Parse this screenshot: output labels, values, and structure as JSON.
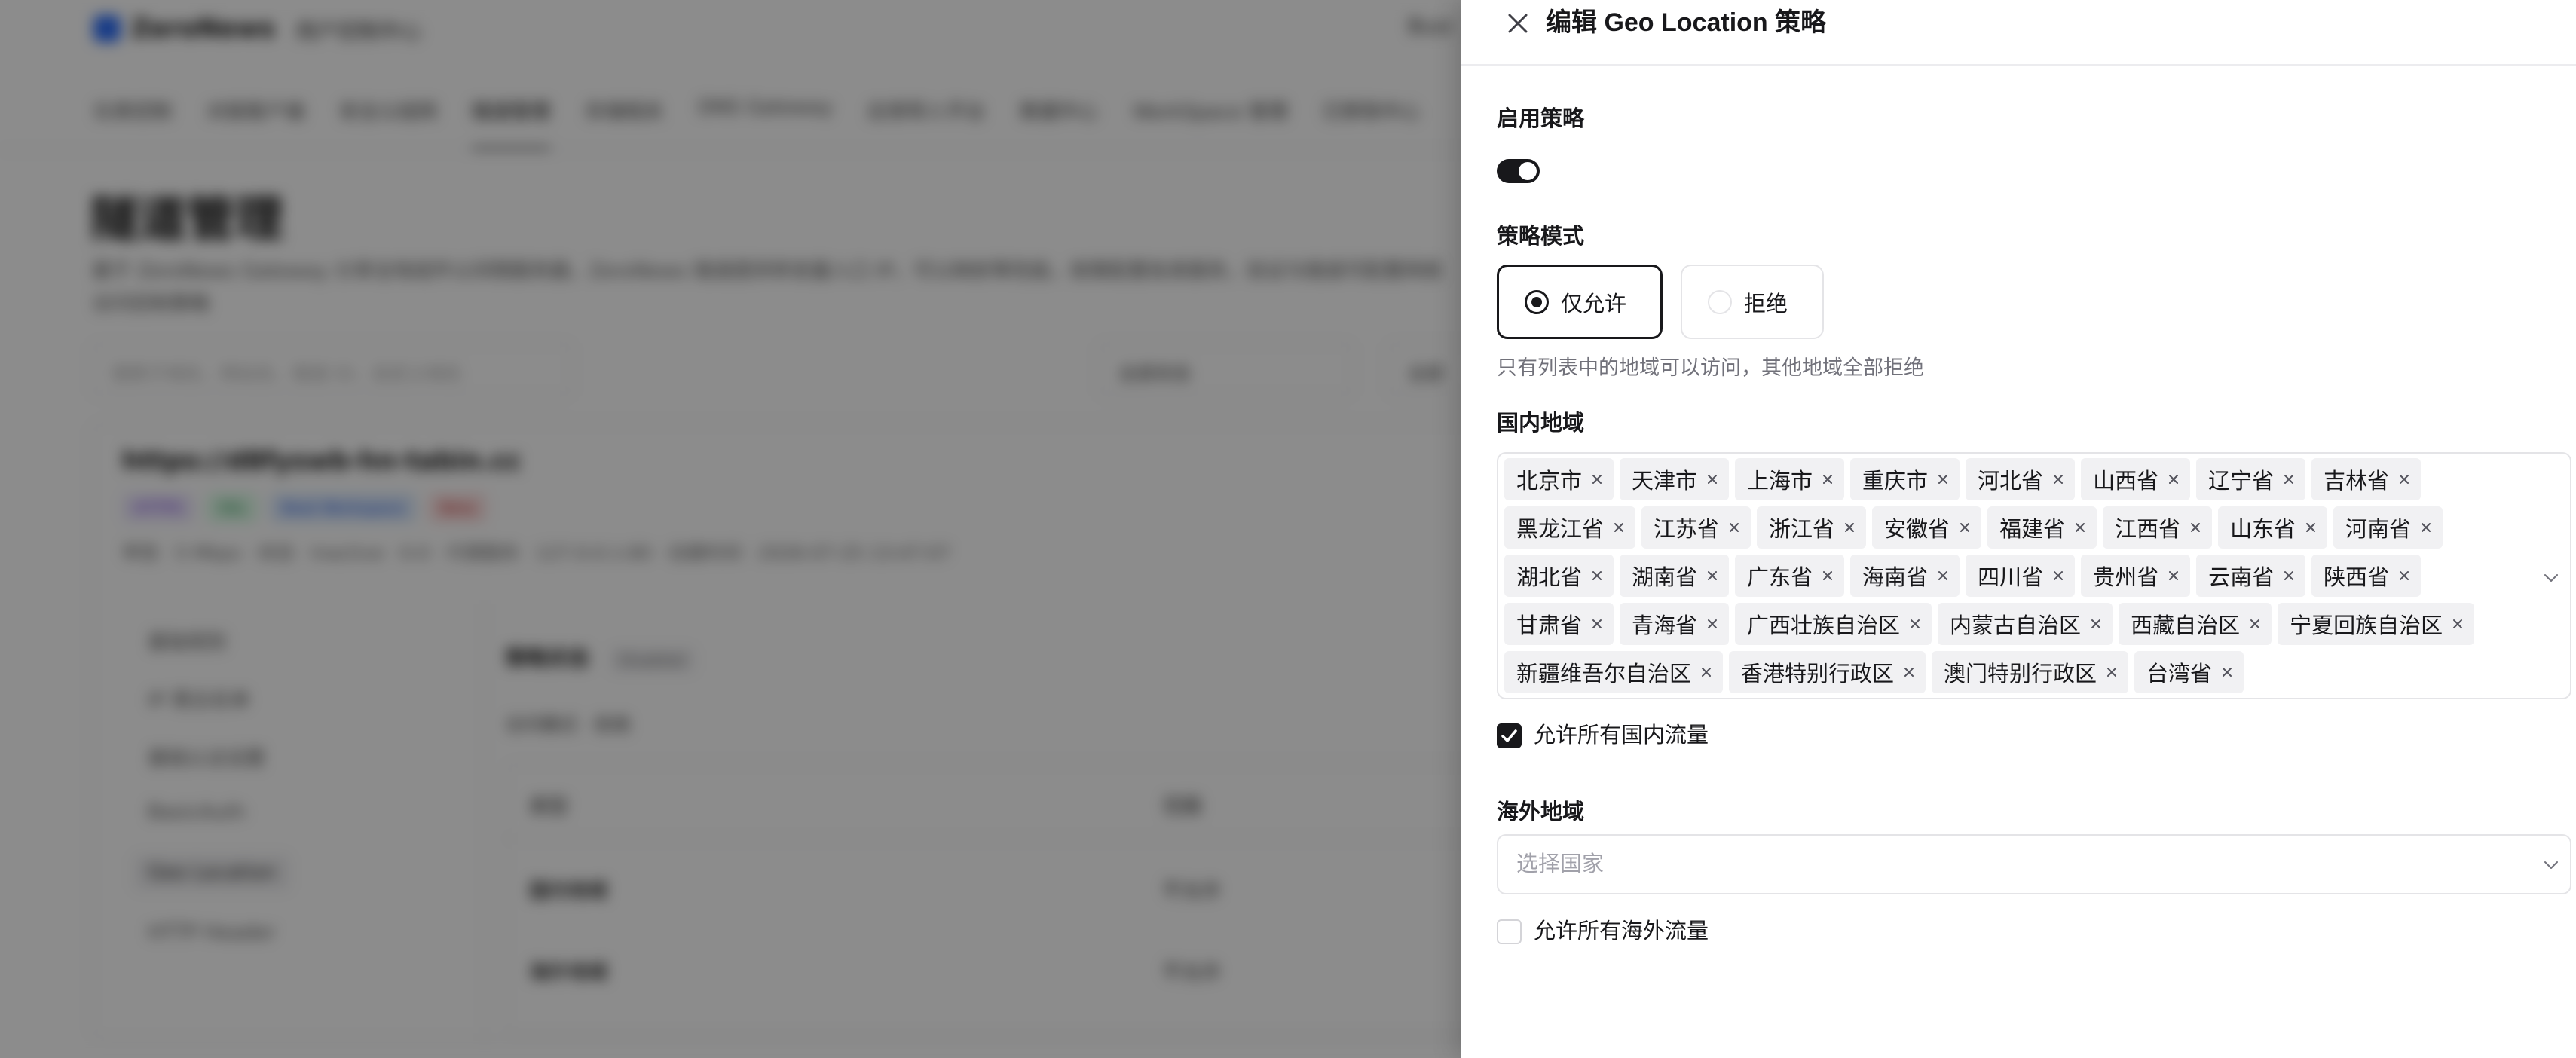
{
  "background": {
    "brand": "ZeroNews",
    "subtitle": "用户控制中心",
    "top_right": "Busi",
    "nav": [
      "仪表控制",
      "对接客户端",
      "安全公组网",
      "隧道管理",
      "存储相关",
      "DNS Gateway",
      "应用导入平台",
      "数据中心",
      "WorkSpace 管理",
      "已移除中心"
    ],
    "page_title": "隧道管理",
    "page_desc": "基于 ZeroNews Gateway 分享全栈组件以间隔服务器，ZeroNews 隧道提供转发量入口 IP，可以映射等性能，按需配置各类服务，验证与隧道可配置网络访问控制策略",
    "search_placeholder": "搜索子域名、网站名、隧道 ID、自定义域名",
    "filter1": "全部状态",
    "filter2": "全部",
    "card": {
      "url": "https://d8fyswb-hn-tabin.cc",
      "tags": [
        "HTTPS",
        "SSL",
        "Beat Workspace",
        "Beta"
      ],
      "meta": "带宽 · 5 Mbps · 状态 · Inactive · 0.0 · 代理服务 · 127.0.0.1:80 · 创建时间 · 2026-07-25 13:47:07",
      "side": [
        "基础规则",
        "IP 黑白名单",
        "基础认证设置",
        "BasicAuth",
        "Geo Location",
        "HTTP Header"
      ],
      "section_title": "策略状态",
      "section_badge": "Disabled",
      "row_label": "访问模式 · 拒绝",
      "table_head": [
        "类型",
        "范围"
      ],
      "table_rows": [
        [
          "国内地域",
          "不允许"
        ],
        [
          "海外地域",
          "不允许"
        ]
      ]
    }
  },
  "drawer": {
    "title": "编辑 Geo Location 策略",
    "enable_label": "启用策略",
    "enabled": true,
    "mode_label": "策略模式",
    "modes": [
      {
        "label": "仅允许",
        "selected": true
      },
      {
        "label": "拒绝",
        "selected": false
      }
    ],
    "mode_hint": "只有列表中的地域可以访问，其他地域全部拒绝",
    "domestic_label": "国内地域",
    "domestic_regions": [
      "北京市",
      "天津市",
      "上海市",
      "重庆市",
      "河北省",
      "山西省",
      "辽宁省",
      "吉林省",
      "黑龙江省",
      "江苏省",
      "浙江省",
      "安徽省",
      "福建省",
      "江西省",
      "山东省",
      "河南省",
      "湖北省",
      "湖南省",
      "广东省",
      "海南省",
      "四川省",
      "贵州省",
      "云南省",
      "陕西省",
      "甘肃省",
      "青海省",
      "广西壮族自治区",
      "内蒙古自治区",
      "西藏自治区",
      "宁夏回族自治区",
      "新疆维吾尔自治区",
      "香港特别行政区",
      "澳门特别行政区",
      "台湾省"
    ],
    "allow_domestic_label": "允许所有国内流量",
    "allow_domestic_checked": true,
    "overseas_label": "海外地域",
    "country_placeholder": "选择国家",
    "allow_overseas_label": "允许所有海外流量",
    "allow_overseas_checked": false
  },
  "icons": {
    "close": "close-icon",
    "tag_remove": "x-icon",
    "dropdown": "chevron-down-icon",
    "check": "check-icon"
  },
  "colors": {
    "primary": "#18181b",
    "tag_bg": "#f1f1f3",
    "border": "#e4e4e7",
    "muted": "#71717a",
    "overlay": "rgba(0,0,0,0.45)"
  }
}
